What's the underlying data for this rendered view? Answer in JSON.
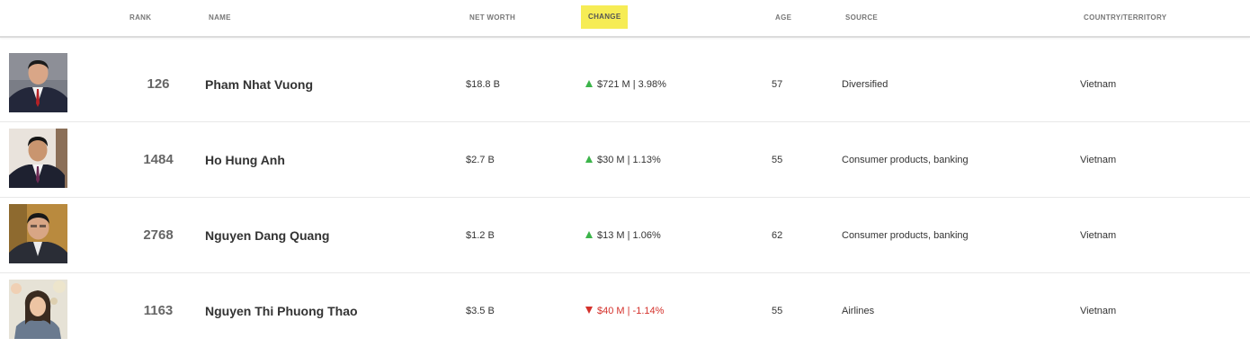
{
  "header": {
    "rank": "RANK",
    "name": "NAME",
    "net_worth": "NET WORTH",
    "change": "CHANGE",
    "age": "AGE",
    "source": "SOURCE",
    "country": "COUNTRY/TERRITORY"
  },
  "colors": {
    "highlight": "#f6ec55",
    "up": "#3cb44a",
    "down": "#d4312b"
  },
  "rows": [
    {
      "rank": "126",
      "name": "Pham Nhat Vuong",
      "net_worth": "$18.8 B",
      "change": "$721 M | 3.98%",
      "direction": "up",
      "age": "57",
      "source": "Diversified",
      "country": "Vietnam"
    },
    {
      "rank": "1484",
      "name": "Ho Hung Anh",
      "net_worth": "$2.7 B",
      "change": "$30 M | 1.13%",
      "direction": "up",
      "age": "55",
      "source": "Consumer products, banking",
      "country": "Vietnam"
    },
    {
      "rank": "2768",
      "name": "Nguyen Dang Quang",
      "net_worth": "$1.2 B",
      "change": "$13 M | 1.06%",
      "direction": "up",
      "age": "62",
      "source": "Consumer products, banking",
      "country": "Vietnam"
    },
    {
      "rank": "1163",
      "name": "Nguyen Thi Phuong Thao",
      "net_worth": "$3.5 B",
      "change": "$40 M | -1.14%",
      "direction": "down",
      "age": "55",
      "source": "Airlines",
      "country": "Vietnam"
    }
  ]
}
